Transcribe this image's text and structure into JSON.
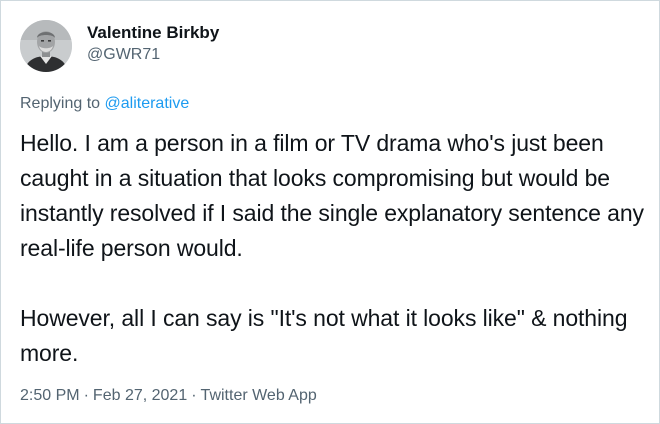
{
  "tweet": {
    "author": {
      "display_name": "Valentine Birkby",
      "handle": "@GWR71"
    },
    "reply": {
      "prefix": "Replying to",
      "mention": "@aliterative"
    },
    "body": {
      "paragraph1": "Hello. I am a person in a film or TV drama who's just been caught in a situation that looks compromising but would be instantly resolved if I said the single explanatory sentence any real-life person would.",
      "paragraph2": "However, all I can say is \"It's not what it looks like\" & nothing more."
    },
    "meta": {
      "time": "2:50 PM",
      "separator": "·",
      "date": "Feb 27, 2021",
      "source": "Twitter Web App"
    }
  },
  "colors": {
    "text": "#0f1419",
    "secondary": "#536471",
    "link": "#1d9bf0",
    "border": "#cfd9de"
  }
}
